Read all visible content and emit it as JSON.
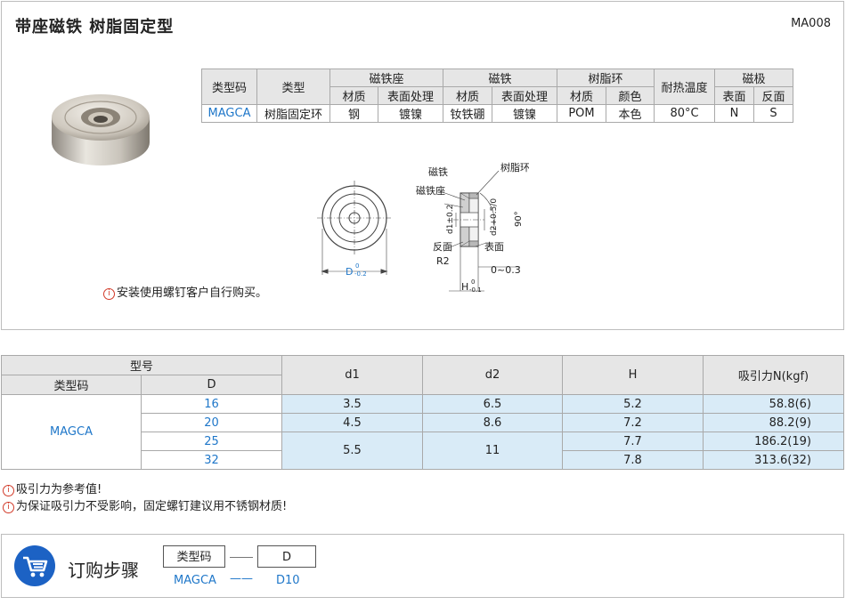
{
  "header": {
    "title": "带座磁铁  树脂固定型",
    "code": "MA008"
  },
  "spec": {
    "h_type_code": "类型码",
    "h_type": "类型",
    "h_base": "磁铁座",
    "h_magnet": "磁铁",
    "h_resin": "树脂环",
    "h_temp": "耐热温度",
    "h_pole": "磁极",
    "h_material": "材质",
    "h_surface": "表面处理",
    "h_color": "颜色",
    "h_front": "表面",
    "h_back": "反面",
    "v_code": "MAGCA",
    "v_type": "树脂固定环",
    "v_base_mat": "钢",
    "v_base_surface": "镀镍",
    "v_mag_mat": "钕铁硼",
    "v_mag_surface": "镀镍",
    "v_resin_mat": "POM",
    "v_resin_color": "本色",
    "v_temp": "80°C",
    "v_front": "N",
    "v_back": "S"
  },
  "drawing": {
    "magnet": "磁铁",
    "base": "磁铁座",
    "resin": "树脂环",
    "back": "反面",
    "front": "表面",
    "r2": "R2",
    "d": "D",
    "d_tol_upper": "0",
    "d_tol_lower": "-0.2",
    "d1": "d1±0.2",
    "d2": "d2+0.5/0",
    "angle": "90°",
    "gap": "0~0.3",
    "h": "H",
    "h_tol_upper": "0",
    "h_tol_lower": "-0.1"
  },
  "note_install": "安装使用螺钉客户自行购买。",
  "dims": {
    "h_model": "型号",
    "h_type_code": "类型码",
    "h_d": "D",
    "h_d1": "d1",
    "h_d2": "d2",
    "h_h": "H",
    "h_force": "吸引力N(kgf)",
    "code": "MAGCA",
    "rows": [
      {
        "D": "16",
        "d1": "3.5",
        "d2": "6.5",
        "H": "5.2",
        "force": "58.8(6)"
      },
      {
        "D": "20",
        "d1": "4.5",
        "d2": "8.6",
        "H": "7.2",
        "force": "88.2(9)"
      },
      {
        "D": "25",
        "d1": "5.5",
        "d2": "11",
        "H": "7.7",
        "force": "186.2(19)"
      },
      {
        "D": "32",
        "H": "7.8",
        "force": "313.6(32)"
      }
    ]
  },
  "notes": [
    "吸引力为参考值!",
    "为保证吸引力不受影响，固定螺钉建议用不锈钢材质!"
  ],
  "order": {
    "title": "订购步骤",
    "col1": "类型码",
    "col2": "D",
    "ex1": "MAGCA",
    "ex2": "D10",
    "dash": "——"
  },
  "colors": {
    "accent": "#1f77c9",
    "highlight": "#d9ebf7",
    "header": "#e6e6e6",
    "cart": "#1c62c4"
  }
}
